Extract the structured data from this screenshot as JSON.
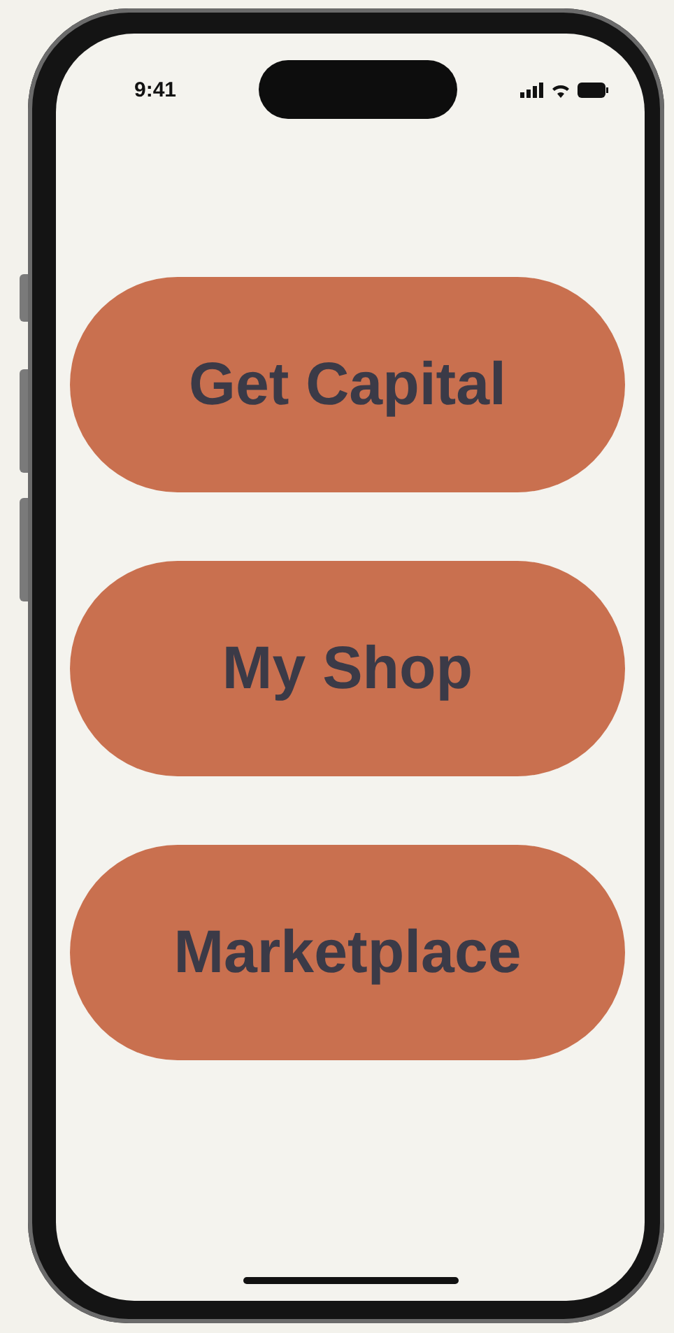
{
  "status_bar": {
    "time": "9:41"
  },
  "buttons": [
    {
      "label": "Get Capital"
    },
    {
      "label": "My Shop"
    },
    {
      "label": "Marketplace"
    }
  ]
}
